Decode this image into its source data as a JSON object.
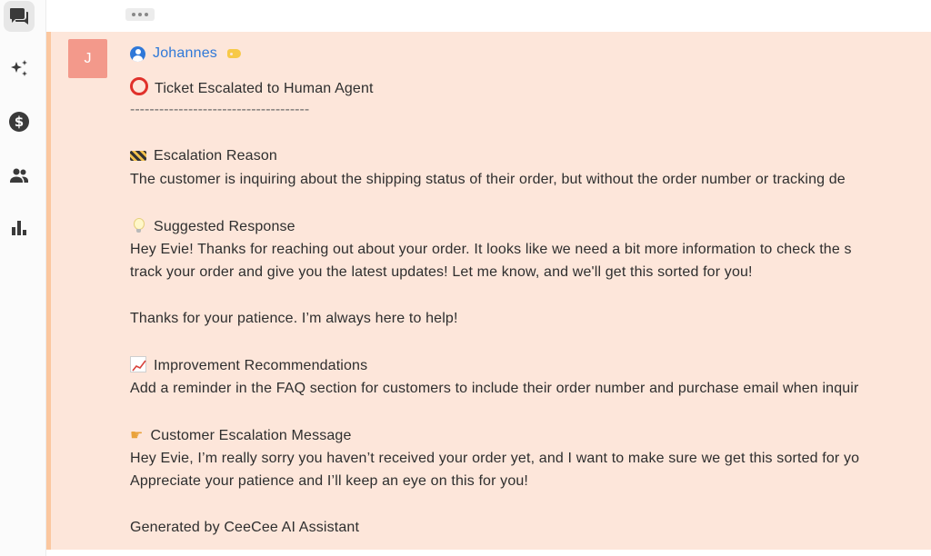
{
  "sidebar": {
    "items": [
      {
        "id": "conversations",
        "icon": "chat-bubbles-icon",
        "active": true
      },
      {
        "id": "ai",
        "icon": "sparkles-icon",
        "active": false
      },
      {
        "id": "billing",
        "icon": "dollar-icon",
        "glyph": "$",
        "active": false
      },
      {
        "id": "contacts",
        "icon": "people-icon",
        "active": false
      },
      {
        "id": "reports",
        "icon": "bar-chart-icon",
        "active": false
      }
    ]
  },
  "collapsed_indicator": "more-dots-icon",
  "message": {
    "avatar_initial": "J",
    "author": "Johannes",
    "author_icon": "user-circle-icon",
    "tag_icon": "label-tag-icon",
    "accent_color": "#fbc79f",
    "background_color": "#fde6da",
    "title": "Ticket Escalated to Human Agent",
    "divider": "-------------------------------------",
    "sections": {
      "reason_heading": "Escalation Reason",
      "reason_text": "The customer is inquiring about the shipping status of their order, but without the order number or tracking de",
      "suggested_heading": "Suggested Response",
      "suggested_line1": "Hey Evie! Thanks for reaching out about your order. It looks like we need a bit more information to check the s",
      "suggested_line2": "track your order and give you the latest updates! Let me know, and we'll get this sorted for you!",
      "suggested_line3": "Thanks for your patience. I’m always here to help!",
      "improvement_heading": "Improvement Recommendations",
      "improvement_text": "Add a reminder in the FAQ section for customers to include their order number and purchase email when inquir",
      "customer_heading": "Customer Escalation Message",
      "customer_line1": "Hey Evie, I’m really sorry you haven’t received your order yet, and I want to make sure we get this sorted for yo",
      "customer_line2": "Appreciate your patience and I’ll keep an eye on this for you!",
      "footer": "Generated by CeeCee AI Assistant"
    }
  }
}
